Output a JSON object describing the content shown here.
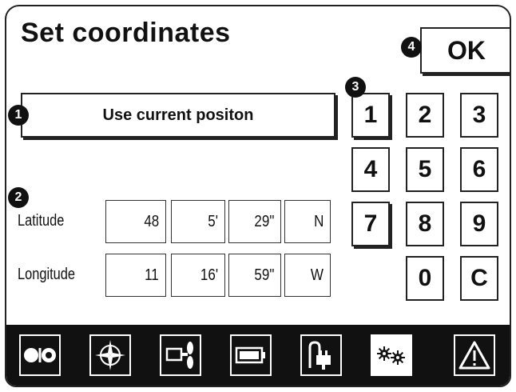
{
  "title": "Set coordinates",
  "ok_label": "OK",
  "use_current_label": "Use current positon",
  "badges": [
    "1",
    "2",
    "3",
    "4"
  ],
  "latitude": {
    "label": "Latitude",
    "degrees": "48",
    "minutes": "5'",
    "seconds": "29\"",
    "hemisphere": "N"
  },
  "longitude": {
    "label": "Longitude",
    "degrees": "11",
    "minutes": "16'",
    "seconds": "59\"",
    "hemisphere": "W"
  },
  "keypad": [
    "1",
    "2",
    "3",
    "4",
    "5",
    "6",
    "7",
    "8",
    "9",
    "0",
    "C"
  ],
  "bottom_tabs": [
    {
      "icon": "toggle-icon",
      "active": false
    },
    {
      "icon": "compass-icon",
      "active": false
    },
    {
      "icon": "propeller-motor-icon",
      "active": false
    },
    {
      "icon": "battery-icon",
      "active": false
    },
    {
      "icon": "power-plug-icon",
      "active": false
    },
    {
      "icon": "settings-gears-icon",
      "active": true
    },
    {
      "icon": "warning-icon",
      "active": false
    }
  ]
}
